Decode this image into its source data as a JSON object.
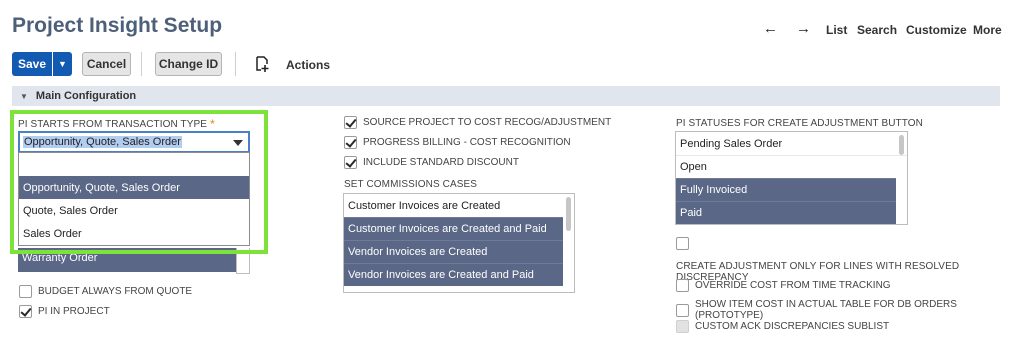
{
  "page": {
    "title": "Project Insight Setup"
  },
  "nav": {
    "back": "←",
    "forward": "→",
    "list": "List",
    "search": "Search",
    "customize": "Customize",
    "more": "More"
  },
  "toolbar": {
    "save": "Save",
    "cancel": "Cancel",
    "change_id": "Change ID",
    "actions": "Actions"
  },
  "section": {
    "title": "Main Configuration"
  },
  "left": {
    "transaction_type_label": "PI STARTS FROM TRANSACTION TYPE",
    "required_mark": "*",
    "selected_value": "Opportunity, Quote, Sales Order",
    "options": [
      {
        "label": "",
        "selected": false
      },
      {
        "label": "Opportunity, Quote, Sales Order",
        "selected": true
      },
      {
        "label": "Quote, Sales Order",
        "selected": false
      },
      {
        "label": "Sales Order",
        "selected": false
      }
    ],
    "underlying_item": "Warranty Order",
    "checkboxes": [
      {
        "label": "BUDGET ALWAYS FROM QUOTE",
        "checked": false
      },
      {
        "label": "PI IN PROJECT",
        "checked": true
      }
    ]
  },
  "middle": {
    "checkboxes": [
      {
        "label": "SOURCE PROJECT TO COST RECOG/ADJUSTMENT",
        "checked": true
      },
      {
        "label": "PROGRESS BILLING - COST RECOGNITION",
        "checked": true
      },
      {
        "label": "INCLUDE STANDARD DISCOUNT",
        "checked": true
      }
    ],
    "commissions_label": "SET COMMISSIONS CASES",
    "commissions": [
      {
        "label": "Customer Invoices are Created",
        "selected": false
      },
      {
        "label": "Customer Invoices are Created and Paid",
        "selected": true
      },
      {
        "label": "Vendor Invoices are Created",
        "selected": true
      },
      {
        "label": "Vendor Invoices are Created and Paid",
        "selected": true
      }
    ]
  },
  "right": {
    "statuses_label": "PI STATUSES FOR CREATE ADJUSTMENT BUTTON",
    "statuses": [
      {
        "label": "Pending Sales Order",
        "selected": false
      },
      {
        "label": "Open",
        "selected": false
      },
      {
        "label": "Fully Invoiced",
        "selected": true
      },
      {
        "label": "Paid",
        "selected": true
      }
    ],
    "resolved_label": "CREATE ADJUSTMENT ONLY FOR LINES WITH RESOLVED DISCREPANCY",
    "checkboxes": [
      {
        "label": "OVERRIDE COST FROM TIME TRACKING",
        "checked": false,
        "disabled": false
      },
      {
        "label": "SHOW ITEM COST IN ACTUAL TABLE FOR DB ORDERS (PROTOTYPE)",
        "checked": false,
        "disabled": false
      },
      {
        "label": "CUSTOM ACK DISCREPANCIES SUBLIST",
        "checked": false,
        "disabled": true
      }
    ]
  },
  "colors": {
    "accent": "#125ab2",
    "selection": "#5a6786",
    "highlight": "#7de23a",
    "title": "#4d5f79"
  }
}
